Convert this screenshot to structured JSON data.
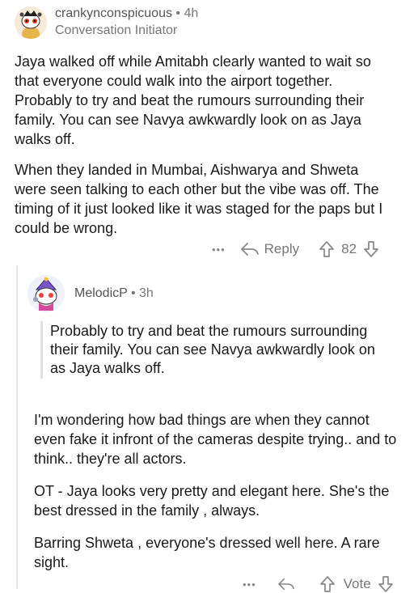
{
  "comment": {
    "username": "crankynconspicuous",
    "separator": "•",
    "time": "4h",
    "flair": "Conversation Initiator",
    "paragraph1": "Jaya walked off while Amitabh clearly wanted to wait so that everyone could walk into the airport together. Probably to try and beat the rumours surrounding their family. You can see Navya awkwardly look on as Jaya walks off.",
    "paragraph2": "When they landed in Mumbai, Aishwarya and Shweta were seen talking to each other but the vibe was off. The timing of it just looked like it was staged for the paps but I could be wrong.",
    "actions": {
      "more": "•••",
      "reply_label": "Reply",
      "score": "82"
    }
  },
  "reply": {
    "username": "MelodicP",
    "separator": "•",
    "time": "3h",
    "quote": "Probably to try and beat the rumours surrounding their family. You can see Navya awkwardly look on as Jaya walks off.",
    "paragraph1": "I'm wondering how bad things are when they cannot even fake it infront of the cameras despite trying.. and to think.. they're all actors.",
    "paragraph2": "OT - Jaya looks very pretty and elegant here. She's the best dressed in the family , always.",
    "paragraph3": "Barring Shweta , everyone's dressed well here. A rare sight.",
    "actions": {
      "more": "•••",
      "vote_label": "Vote"
    }
  }
}
